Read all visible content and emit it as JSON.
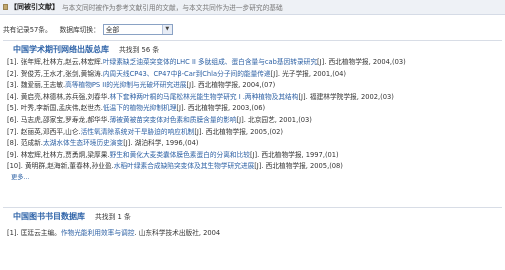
{
  "header": {
    "title": "【同被引文献】",
    "description": "与本文同时被作为参考文献引用的文献，与本文共同作为进一步研究的基础"
  },
  "filter": {
    "total_label": "共有记录57条。",
    "db_label": "数据库切换：",
    "db_selected": "全部"
  },
  "sections": [
    {
      "title": "中国学术期刊网络出版总库",
      "count": "共找到  56 条",
      "items": [
        {
          "num": "[1].",
          "authors": "张年辉,杜林方,赵云,林宏辉.",
          "title": "叶绿素缺乏油菜突变体的LHC II 多肽组成、蛋白含量与cab基因转录研究",
          "journal": "[J].",
          "source": "西北植物学报, 2004,(03)"
        },
        {
          "num": "[2].",
          "authors": "贺俊芳,王水才,张剑,黄锦涛.",
          "title": "内周天线CP43、CP47中β-Car到Chla分子间的能量传递",
          "journal": "[J].",
          "source": "光子学报, 2001,(04)"
        },
        {
          "num": "[3].",
          "authors": "魏爱丽,王志敏.",
          "title": "高等植物PS II的光抑制与光破坏研究进展",
          "journal": "[J].",
          "source": "西北植物学报, 2004,(07)"
        },
        {
          "num": "[4].",
          "authors": "黄启亮,林德林,苏兵强,刘春华.",
          "title": "林下套种两叶桐的马尾松林光能生物学研究 I .两种植物及其结构",
          "journal": "[J].",
          "source": "福建林学院学报, 2002,(03)"
        },
        {
          "num": "[5].",
          "authors": "叶秀,李新国,孟庆伟,赵世杰.",
          "title": "低温下的植物光抑制机理",
          "journal": "[J].",
          "source": "西北植物学报, 2003,(06)"
        },
        {
          "num": "[6].",
          "authors": "马志虎,邵家宝,罗寿龙,郝华华.",
          "title": "薄被黄被苗突变体对色素和质膜含量的影响",
          "journal": "[J].",
          "source": "北京园艺, 2001,(03)"
        },
        {
          "num": "[7].",
          "authors": "赵丽英,邓西平,山仑.",
          "title": "活性氧清除系统对干旱胁迫的响应机制",
          "journal": "[J].",
          "source": "西北植物学报, 2005,(02)"
        },
        {
          "num": "[8].",
          "authors": "范成新.",
          "title": "太湖水体生态环境历史演变",
          "journal": "[J].",
          "source": "湖泊科学, 1996,(04)"
        },
        {
          "num": "[9].",
          "authors": "林宏辉,杜林方,贾勇炯,梁厚果.",
          "title": "野生和黄化大麦类囊体膜色素蛋白的分离和比较",
          "journal": "[J].",
          "source": "西北植物学报, 1997,(01)"
        },
        {
          "num": "[10].",
          "authors": "黄明群,赵海新,董春林,孙业盈.",
          "title": "水稻叶绿素合成缺陷突变体及其生物学研究进展",
          "journal": "[J].",
          "source": "西北植物学报, 2005,(08)"
        }
      ],
      "more": "更多..."
    },
    {
      "title": "中国图书书目数据库",
      "count": "共找到 1 条",
      "items": [
        {
          "num": "[1].",
          "authors": "匡廷云主编。",
          "title": "作物光能利用效率与调控",
          "journal": ".",
          "source": "山东科学技术出版社, 2004"
        }
      ]
    }
  ]
}
